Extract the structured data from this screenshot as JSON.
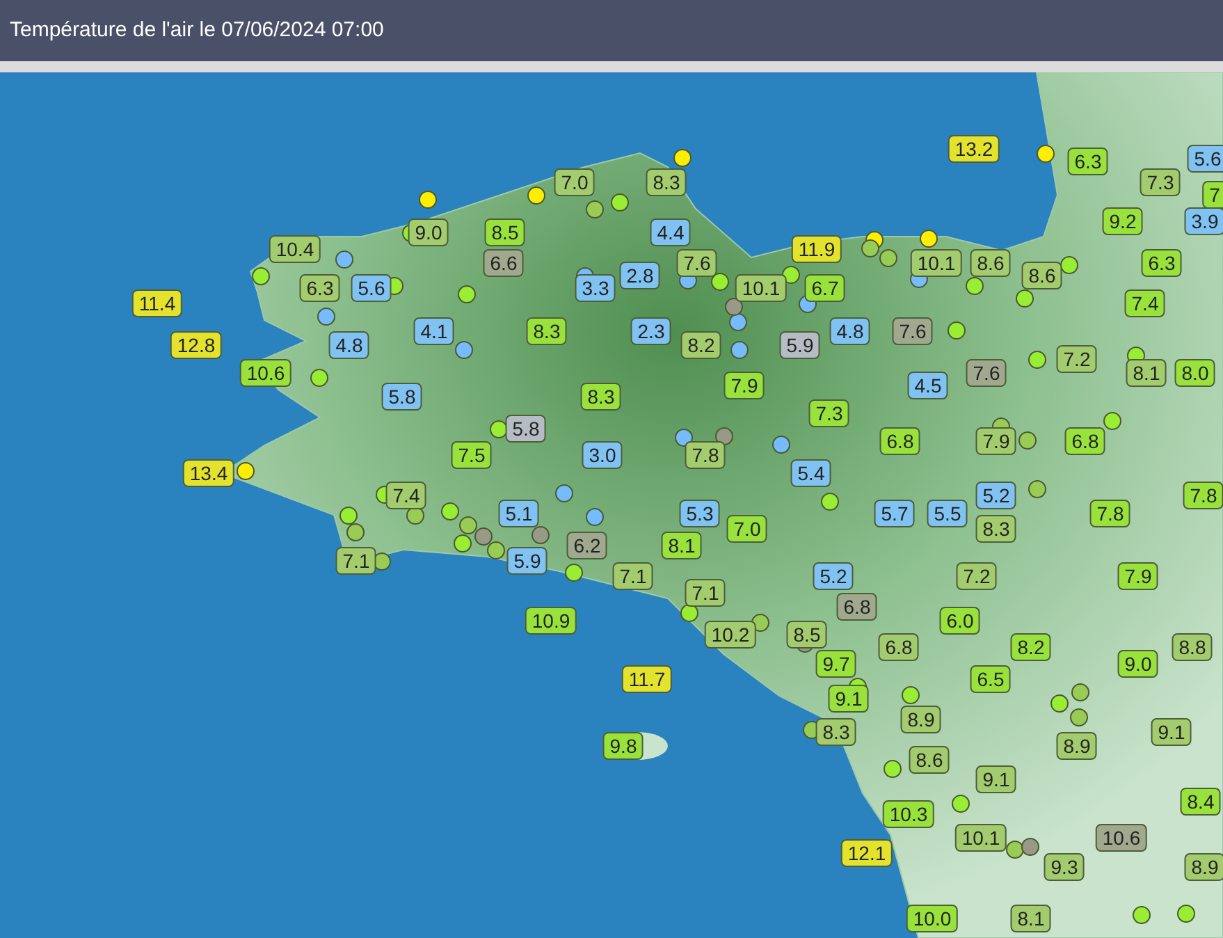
{
  "header": {
    "title": "Température de l'air le 07/06/2024 07:00"
  },
  "map": {
    "labels": [
      {
        "text": "13.2",
        "color": "#e3e32e"
      },
      {
        "text": "6.3",
        "color": "#99e23c"
      },
      {
        "text": "5.6",
        "color": "#80c2f2"
      },
      {
        "text": "7.0",
        "color": "#a3cc6e"
      },
      {
        "text": "8.3",
        "color": "#a3cc6e"
      },
      {
        "text": "7.3",
        "color": "#a3cc6e"
      },
      {
        "text": "7",
        "color": "#99e23c"
      },
      {
        "text": "9.2",
        "color": "#99e23c"
      },
      {
        "text": "3.9",
        "color": "#80c2f2"
      },
      {
        "text": "9.0",
        "color": "#a3cc6e"
      },
      {
        "text": "8.5",
        "color": "#99e23c"
      },
      {
        "text": "4.4",
        "color": "#80c2f2"
      },
      {
        "text": "10.4",
        "color": "#a3cc6e"
      },
      {
        "text": "11.9",
        "color": "#e3e32e"
      },
      {
        "text": "6.6",
        "color": "#a0a88e"
      },
      {
        "text": "7.6",
        "color": "#a3cc6e"
      },
      {
        "text": "10.1",
        "color": "#a3cc6e"
      },
      {
        "text": "8.6",
        "color": "#a3cc6e"
      },
      {
        "text": "6.3",
        "color": "#99e23c"
      },
      {
        "text": "2.8",
        "color": "#80c2f2"
      },
      {
        "text": "8.6",
        "color": "#a3cc6e"
      },
      {
        "text": "6.3",
        "color": "#a3cc6e"
      },
      {
        "text": "5.6",
        "color": "#80c2f2"
      },
      {
        "text": "3.3",
        "color": "#80c2f2"
      },
      {
        "text": "10.1",
        "color": "#a3cc6e"
      },
      {
        "text": "6.7",
        "color": "#99e23c"
      },
      {
        "text": "11.4",
        "color": "#e3e32e"
      },
      {
        "text": "7.4",
        "color": "#99e23c"
      },
      {
        "text": "4.1",
        "color": "#80c2f2"
      },
      {
        "text": "8.3",
        "color": "#99e23c"
      },
      {
        "text": "2.3",
        "color": "#80c2f2"
      },
      {
        "text": "4.8",
        "color": "#80c2f2"
      },
      {
        "text": "7.6",
        "color": "#a0a88e"
      },
      {
        "text": "12.8",
        "color": "#e3e32e"
      },
      {
        "text": "4.8",
        "color": "#80c2f2"
      },
      {
        "text": "8.2",
        "color": "#a3cc6e"
      },
      {
        "text": "5.9",
        "color": "#b5bcc4"
      },
      {
        "text": "7.2",
        "color": "#a3cc6e"
      },
      {
        "text": "10.6",
        "color": "#99e23c"
      },
      {
        "text": "7.6",
        "color": "#a0a88e"
      },
      {
        "text": "8.1",
        "color": "#a3cc6e"
      },
      {
        "text": "8.0",
        "color": "#99e23c"
      },
      {
        "text": "7.9",
        "color": "#99e23c"
      },
      {
        "text": "4.5",
        "color": "#80c2f2"
      },
      {
        "text": "5.8",
        "color": "#80c2f2"
      },
      {
        "text": "8.3",
        "color": "#99e23c"
      },
      {
        "text": "7.3",
        "color": "#99e23c"
      },
      {
        "text": "5.8",
        "color": "#b5bcc4"
      },
      {
        "text": "6.8",
        "color": "#99e23c"
      },
      {
        "text": "7.9",
        "color": "#a3cc6e"
      },
      {
        "text": "6.8",
        "color": "#99e23c"
      },
      {
        "text": "7.5",
        "color": "#99e23c"
      },
      {
        "text": "3.0",
        "color": "#80c2f2"
      },
      {
        "text": "7.8",
        "color": "#a3cc6e"
      },
      {
        "text": "13.4",
        "color": "#e3e32e"
      },
      {
        "text": "5.4",
        "color": "#80c2f2"
      },
      {
        "text": "7.4",
        "color": "#a3cc6e"
      },
      {
        "text": "5.2",
        "color": "#80c2f2"
      },
      {
        "text": "7.8",
        "color": "#99e23c"
      },
      {
        "text": "5.1",
        "color": "#80c2f2"
      },
      {
        "text": "5.3",
        "color": "#80c2f2"
      },
      {
        "text": "5.7",
        "color": "#80c2f2"
      },
      {
        "text": "5.5",
        "color": "#80c2f2"
      },
      {
        "text": "7.8",
        "color": "#99e23c"
      },
      {
        "text": "7.0",
        "color": "#99e23c"
      },
      {
        "text": "8.3",
        "color": "#a3cc6e"
      },
      {
        "text": "6.2",
        "color": "#a0a88e"
      },
      {
        "text": "8.1",
        "color": "#99e23c"
      },
      {
        "text": "7.1",
        "color": "#a3cc6e"
      },
      {
        "text": "5.9",
        "color": "#80c2f2"
      },
      {
        "text": "7.1",
        "color": "#a3cc6e"
      },
      {
        "text": "5.2",
        "color": "#80c2f2"
      },
      {
        "text": "7.2",
        "color": "#a3cc6e"
      },
      {
        "text": "7.9",
        "color": "#99e23c"
      },
      {
        "text": "7.1",
        "color": "#a3cc6e"
      },
      {
        "text": "6.8",
        "color": "#a0a88e"
      },
      {
        "text": "10.9",
        "color": "#99e23c"
      },
      {
        "text": "6.0",
        "color": "#99e23c"
      },
      {
        "text": "10.2",
        "color": "#a3cc6e"
      },
      {
        "text": "8.5",
        "color": "#a3cc6e"
      },
      {
        "text": "6.8",
        "color": "#a3cc6e"
      },
      {
        "text": "8.2",
        "color": "#99e23c"
      },
      {
        "text": "8.8",
        "color": "#a3cc6e"
      },
      {
        "text": "9.7",
        "color": "#99e23c"
      },
      {
        "text": "9.0",
        "color": "#99e23c"
      },
      {
        "text": "11.7",
        "color": "#e3e32e"
      },
      {
        "text": "6.5",
        "color": "#99e23c"
      },
      {
        "text": "9.1",
        "color": "#99e23c"
      },
      {
        "text": "8.9",
        "color": "#a3cc6e"
      },
      {
        "text": "8.3",
        "color": "#a3cc6e"
      },
      {
        "text": "9.1",
        "color": "#a3cc6e"
      },
      {
        "text": "9.8",
        "color": "#99e23c"
      },
      {
        "text": "8.9",
        "color": "#a3cc6e"
      },
      {
        "text": "8.6",
        "color": "#a3cc6e"
      },
      {
        "text": "9.1",
        "color": "#a3cc6e"
      },
      {
        "text": "8.4",
        "color": "#99e23c"
      },
      {
        "text": "10.3",
        "color": "#99e23c"
      },
      {
        "text": "10.1",
        "color": "#a3cc6e"
      },
      {
        "text": "10.6",
        "color": "#a0a88e"
      },
      {
        "text": "12.1",
        "color": "#e3e32e"
      },
      {
        "text": "9.3",
        "color": "#a3cc6e"
      },
      {
        "text": "8.9",
        "color": "#a3cc6e"
      },
      {
        "text": "10.0",
        "color": "#99e23c"
      },
      {
        "text": "8.1",
        "color": "#a3cc6e"
      }
    ],
    "stations": [
      {
        "color": "#ffee00"
      },
      {
        "color": "#ffee00"
      },
      {
        "color": "#ffee00"
      },
      {
        "color": "#ffee00"
      },
      {
        "color": "#ffee00"
      },
      {
        "color": "#ffee00"
      },
      {
        "color": "#ffee00"
      },
      {
        "color": "#77bbff"
      },
      {
        "color": "#77bbff"
      },
      {
        "color": "#77bbff"
      },
      {
        "color": "#77bbff"
      },
      {
        "color": "#77bbff"
      },
      {
        "color": "#77bbff"
      },
      {
        "color": "#77bbff"
      },
      {
        "color": "#77bbff"
      },
      {
        "color": "#77bbff"
      },
      {
        "color": "#77bbff"
      },
      {
        "color": "#77bbff"
      },
      {
        "color": "#77bbff"
      },
      {
        "color": "#77bbff"
      },
      {
        "color": "#99ee33"
      },
      {
        "color": "#99ee33"
      },
      {
        "color": "#99ee33"
      },
      {
        "color": "#99ee33"
      },
      {
        "color": "#99ee33"
      },
      {
        "color": "#99ee33"
      },
      {
        "color": "#99ee33"
      },
      {
        "color": "#99ee33"
      },
      {
        "color": "#99ee33"
      },
      {
        "color": "#99ee33"
      },
      {
        "color": "#99ee33"
      },
      {
        "color": "#99ee33"
      },
      {
        "color": "#99ee33"
      },
      {
        "color": "#99ee33"
      },
      {
        "color": "#99ee33"
      },
      {
        "color": "#99ee33"
      },
      {
        "color": "#99ee33"
      },
      {
        "color": "#99ee33"
      },
      {
        "color": "#99ee33"
      },
      {
        "color": "#99ee33"
      },
      {
        "color": "#99ee33"
      },
      {
        "color": "#99ee33"
      },
      {
        "color": "#99ee33"
      },
      {
        "color": "#99ee33"
      },
      {
        "color": "#99ee33"
      },
      {
        "color": "#99ee33"
      },
      {
        "color": "#99ee33"
      },
      {
        "color": "#99ee33"
      },
      {
        "color": "#99ee33"
      },
      {
        "color": "#99ee33"
      },
      {
        "color": "#99cc55"
      },
      {
        "color": "#99cc55"
      },
      {
        "color": "#99cc55"
      },
      {
        "color": "#99cc55"
      },
      {
        "color": "#99cc55"
      },
      {
        "color": "#99cc55"
      },
      {
        "color": "#99cc55"
      },
      {
        "color": "#99cc55"
      },
      {
        "color": "#99cc55"
      },
      {
        "color": "#99cc55"
      },
      {
        "color": "#99cc55"
      },
      {
        "color": "#99cc55"
      },
      {
        "color": "#99cc55"
      },
      {
        "color": "#99cc55"
      },
      {
        "color": "#99cc55"
      },
      {
        "color": "#99cc55"
      },
      {
        "color": "#999988"
      },
      {
        "color": "#999988"
      },
      {
        "color": "#999988"
      },
      {
        "color": "#999988"
      },
      {
        "color": "#999988"
      },
      {
        "color": "#999988"
      }
    ]
  }
}
